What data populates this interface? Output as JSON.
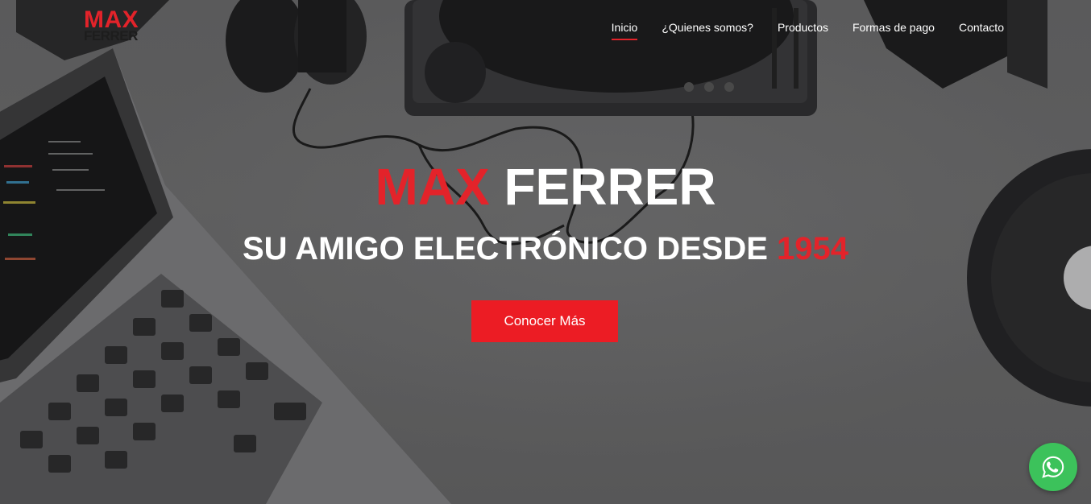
{
  "brand": {
    "logo_line1": "MAX",
    "logo_line2": "FERRER",
    "accent_color": "#e3232a"
  },
  "nav": {
    "items": [
      {
        "label": "Inicio",
        "active": true
      },
      {
        "label": "¿Quienes somos?"
      },
      {
        "label": "Productos"
      },
      {
        "label": "Formas de pago"
      },
      {
        "label": "Contacto"
      }
    ]
  },
  "hero": {
    "title_red": "MAX",
    "title_white": "FERRER",
    "subtitle_white": "SU AMIGO ELECTRÓNICO DESDE",
    "subtitle_red": "1954",
    "cta_label": "Conocer Más"
  },
  "floating": {
    "whatsapp_icon": "whatsapp-icon",
    "whatsapp_color": "#3cc25b"
  }
}
